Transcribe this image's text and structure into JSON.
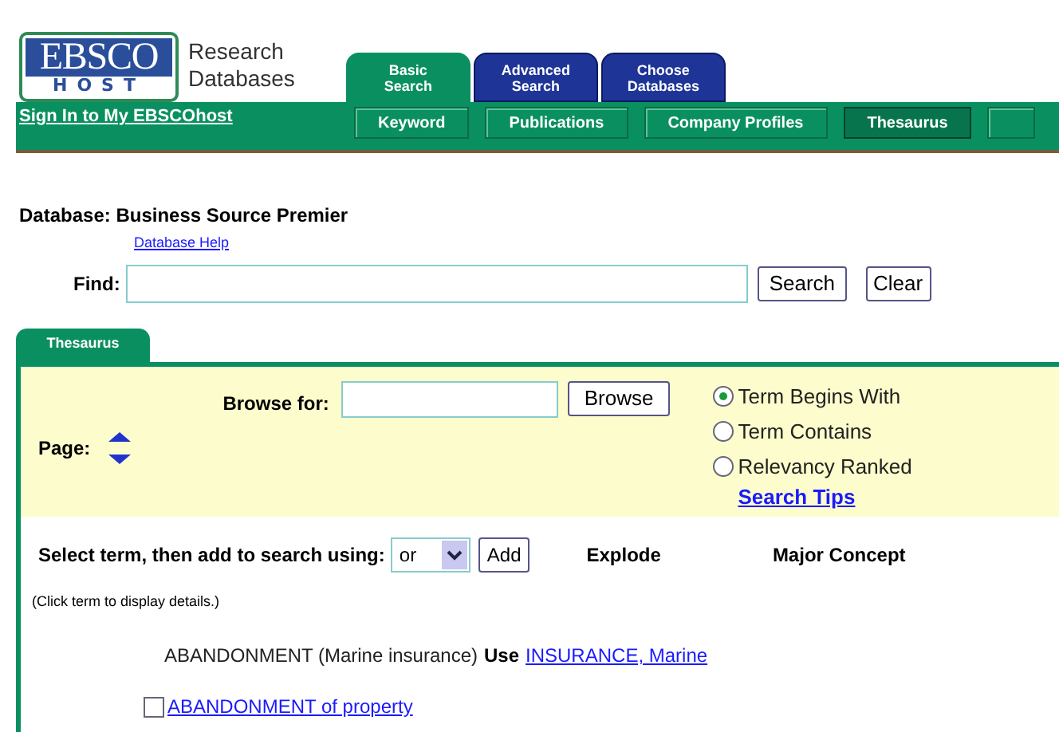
{
  "logo": {
    "top": "EBSCO",
    "bottom": "HOST",
    "tagline_1": "Research",
    "tagline_2": "Databases"
  },
  "tabs": [
    {
      "label_1": "Basic",
      "label_2": "Search",
      "selected": true
    },
    {
      "label_1": "Advanced",
      "label_2": "Search",
      "selected": false
    },
    {
      "label_1": "Choose",
      "label_2": "Databases",
      "selected": false
    }
  ],
  "sign_in": "Sign In to My EBSCOhost",
  "subtabs": [
    {
      "label": "Keyword",
      "selected": false
    },
    {
      "label": "Publications",
      "selected": false
    },
    {
      "label": "Company Profiles",
      "selected": false
    },
    {
      "label": "Thesaurus",
      "selected": true
    },
    {
      "selected": false
    }
  ],
  "database": "Database: Business Source Premier",
  "database_help": "Database Help",
  "find": {
    "label": "Find:",
    "buttons": [
      "Search",
      "Clear"
    ]
  },
  "panel_tab": "Thesaurus",
  "page_label": "Page:",
  "browse": {
    "label": "Browse for:",
    "button": "Browse"
  },
  "options": [
    {
      "label": "Term Begins With",
      "selected": true
    },
    {
      "label": "Term Contains",
      "selected": false
    },
    {
      "label": "Relevancy Ranked",
      "selected": false
    }
  ],
  "search_tips": "Search Tips",
  "select_row": {
    "label": "Select term, then add to search using:",
    "operator": "or",
    "button": "Add",
    "col_1": "Explode",
    "col_2": "Major Concept"
  },
  "hint": "(Click term to display details.)",
  "terms": [
    {
      "kind": "use",
      "term": "ABANDONMENT (Marine insurance)",
      "use": "Use",
      "link": "INSURANCE, Marine"
    },
    {
      "kind": "check",
      "term": "ABANDONMENT of property",
      "checked": false
    }
  ]
}
